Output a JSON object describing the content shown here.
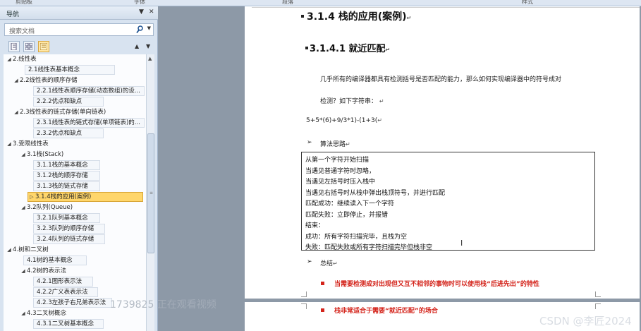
{
  "ribbon": {
    "labels": [
      "剪贴板",
      "字体",
      "段落",
      "样式"
    ]
  },
  "nav": {
    "title": "导航",
    "search_placeholder": "搜索文档",
    "items": [
      {
        "label": "2.线性表",
        "toggle": "◢"
      },
      {
        "label": "2.1线性表基本概念",
        "toggle": ""
      },
      {
        "label": "2.2线性表的顺序存储",
        "toggle": "◢"
      },
      {
        "label": "2.2.1线性表顺序存储(动态数组)的设...",
        "toggle": ""
      },
      {
        "label": "2.2.2优点和缺点",
        "toggle": ""
      },
      {
        "label": "2.3线性表的链式存储(单向链表)",
        "toggle": "◢"
      },
      {
        "label": "2.3.1线性表的链式存储(单项链表)的...",
        "toggle": ""
      },
      {
        "label": "2.3.2优点和缺点",
        "toggle": ""
      },
      {
        "label": "3.受限线性表",
        "toggle": "◢"
      },
      {
        "label": "3.1栈(Stack)",
        "toggle": "◢"
      },
      {
        "label": "3.1.1栈的基本概念",
        "toggle": ""
      },
      {
        "label": "3.1.2栈的顺序存储",
        "toggle": ""
      },
      {
        "label": "3.1.3栈的链式存储",
        "toggle": ""
      },
      {
        "label": "3.1.4栈的应用(案例)",
        "toggle": "▷"
      },
      {
        "label": "3.2队列(Queue)",
        "toggle": "◢"
      },
      {
        "label": "3.2.1队列基本概念",
        "toggle": ""
      },
      {
        "label": "3.2.3队列的顺序存储",
        "toggle": ""
      },
      {
        "label": "3.2.4队列的链式存储",
        "toggle": ""
      },
      {
        "label": "4.树和二叉树",
        "toggle": "◢"
      },
      {
        "label": "4.1树的基本概念",
        "toggle": ""
      },
      {
        "label": "4.2树的表示法",
        "toggle": "◢"
      },
      {
        "label": "4.2.1图形表示法",
        "toggle": ""
      },
      {
        "label": "4.2.2广义表表示法",
        "toggle": ""
      },
      {
        "label": "4.2.3左孩子右兄弟表示法",
        "toggle": ""
      },
      {
        "label": "4.3二叉树概念",
        "toggle": "◢"
      },
      {
        "label": "4.3.1二叉树基本概念",
        "toggle": ""
      }
    ]
  },
  "doc": {
    "heading1": "3.1.4 栈的应用(案例)",
    "heading2": "3.1.4.1 就近匹配",
    "para1": "几乎所有的编译器都具有检测括号是否匹配的能力，那么如何实现编译器中的符号成对",
    "para2": "检测？如下字符串：",
    "expr": "5+5*(6)+9/3*1)-(1+3(",
    "algo_label": "算法思路",
    "box_lines": [
      "从第一个字符开始扫描",
      "当遇见普通字符时忽略，",
      "当遇见左括号时压入栈中",
      "当遇见右括号时从栈中弹出栈顶符号，并进行匹配",
      "匹配成功：继续读入下一个字符",
      "匹配失败：立即停止，并报错",
      "结束：",
      "成功：所有字符扫描完毕，且栈为空",
      "失败：匹配失败或所有字符扫描完毕但栈非空"
    ],
    "summary_label": "总结",
    "red1": "当需要检测成对出现但又互不相邻的事物时可以使用栈“后进先出”的特性",
    "red2": "栈非常适合于需要“就近匹配”的场合"
  },
  "overlay": "1739825 正在观看视频",
  "watermark": "CSDN @李匠2024",
  "colors": {
    "selected": "#ffd66b",
    "accent_red": "#d4241b",
    "nav_bg": "#d8e3f0"
  }
}
